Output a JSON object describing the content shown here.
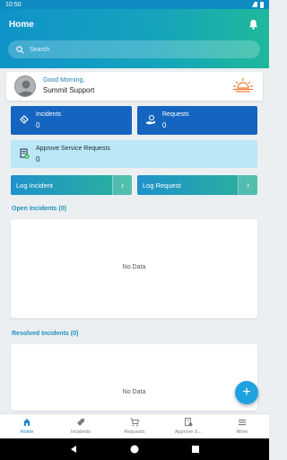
{
  "status_bar": {
    "time": "10:50"
  },
  "header": {
    "title": "Home"
  },
  "search": {
    "placeholder": "Search"
  },
  "greeting": {
    "line1": "Good Morning,",
    "name": "Summit Support"
  },
  "tiles": {
    "incidents": {
      "label": "Incidents",
      "count": "0"
    },
    "requests": {
      "label": "Requests",
      "count": "0"
    },
    "approve": {
      "label": "Approve Service Requests",
      "count": "0"
    }
  },
  "actions": {
    "log_incident": "Log Incident",
    "log_request": "Log Request"
  },
  "open_incidents": {
    "title": "Open Incidents (0)",
    "empty": "No Data"
  },
  "resolved_incidents": {
    "title": "Resolved Incidents (0)",
    "empty": "No Data"
  },
  "bottom_nav": {
    "items": [
      {
        "label": "Home",
        "icon": "home-icon",
        "active": true
      },
      {
        "label": "Incidents",
        "icon": "tag-icon"
      },
      {
        "label": "Requests",
        "icon": "cart-icon"
      },
      {
        "label": "Approve S...",
        "icon": "approve-doc-icon"
      },
      {
        "label": "More",
        "icon": "menu-icon"
      }
    ]
  },
  "colors": {
    "accent": "#1e88c9",
    "tile_blue": "#1565c0",
    "approve_bg": "#bce7f6"
  }
}
